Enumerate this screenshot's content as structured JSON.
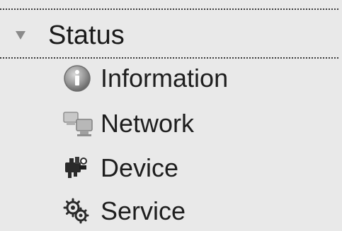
{
  "section": {
    "title": "Status",
    "expanded": true
  },
  "menu": {
    "items": [
      {
        "label": "Information",
        "icon": "info-icon"
      },
      {
        "label": "Network",
        "icon": "network-icon"
      },
      {
        "label": "Device",
        "icon": "device-icon"
      },
      {
        "label": "Service",
        "icon": "service-icon"
      }
    ]
  }
}
